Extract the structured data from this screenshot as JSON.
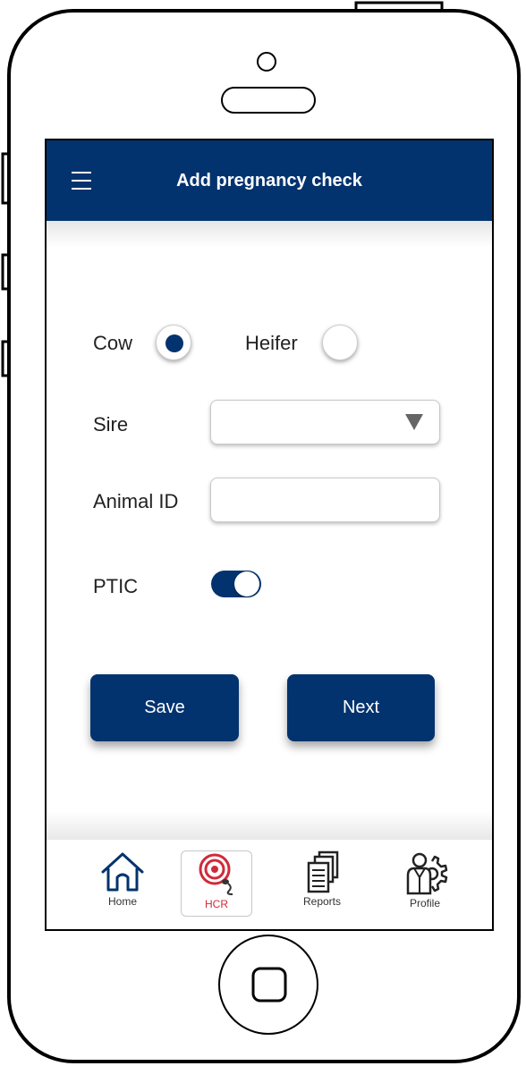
{
  "header": {
    "title": "Add pregnancy check",
    "menu_icon": "hamburger-menu-icon"
  },
  "form": {
    "animal_type": {
      "options": [
        "Cow",
        "Heifer"
      ],
      "selected": "Cow"
    },
    "sire": {
      "label": "Sire",
      "value": ""
    },
    "animal_id": {
      "label": "Animal ID",
      "value": ""
    },
    "ptic": {
      "label": "PTIC",
      "on": true
    }
  },
  "buttons": {
    "save": "Save",
    "next": "Next"
  },
  "nav": {
    "items": [
      {
        "label": "Home",
        "icon": "home-icon"
      },
      {
        "label": "HCR",
        "icon": "hcr-icon"
      },
      {
        "label": "Reports",
        "icon": "reports-icon"
      },
      {
        "label": "Profile",
        "icon": "profile-icon"
      }
    ],
    "active": "HCR"
  },
  "colors": {
    "primary": "#03336e",
    "accent": "#d02a3a"
  }
}
